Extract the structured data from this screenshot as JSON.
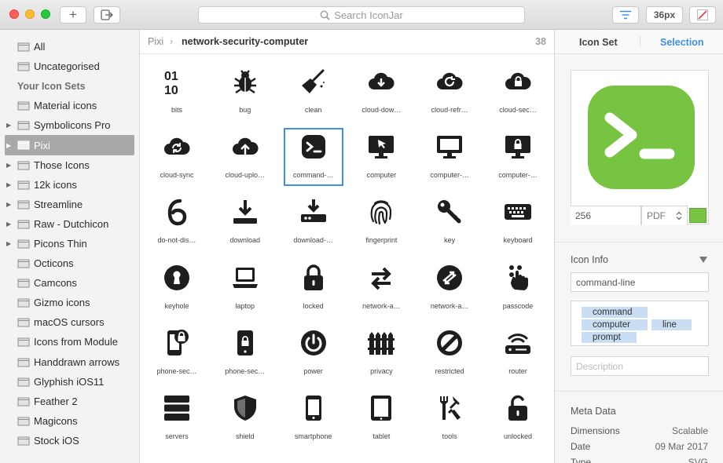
{
  "toolbar": {
    "add_label": "+",
    "search_placeholder": "Search IconJar",
    "size_label": "36px"
  },
  "sidebar": {
    "top_items": [
      {
        "label": "All"
      },
      {
        "label": "Uncategorised"
      }
    ],
    "sets_header": "Your Icon Sets",
    "sets": [
      {
        "label": "Material icons",
        "expandable": false
      },
      {
        "label": "Symbolicons Pro",
        "expandable": true
      },
      {
        "label": "Pixi",
        "expandable": true,
        "selected": true
      },
      {
        "label": "Those Icons",
        "expandable": true
      },
      {
        "label": "12k icons",
        "expandable": true
      },
      {
        "label": "Streamline",
        "expandable": true
      },
      {
        "label": "Raw - Dutchicon",
        "expandable": true
      },
      {
        "label": "Picons Thin",
        "expandable": true
      },
      {
        "label": "Octicons",
        "expandable": false
      },
      {
        "label": "Camcons",
        "expandable": false
      },
      {
        "label": "Gizmo icons",
        "expandable": false
      },
      {
        "label": "macOS cursors",
        "expandable": false
      },
      {
        "label": "Icons from Module",
        "expandable": false
      },
      {
        "label": "Handdrawn arrows",
        "expandable": false
      },
      {
        "label": "Glyphish iOS11",
        "expandable": false
      },
      {
        "label": "Feather 2",
        "expandable": false
      },
      {
        "label": "Magicons",
        "expandable": false
      },
      {
        "label": "Stock iOS",
        "expandable": false
      }
    ]
  },
  "main": {
    "breadcrumb_parent": "Pixi",
    "breadcrumb_sep": "›",
    "breadcrumb_current": "network-security-computer",
    "count": "38",
    "icons": [
      {
        "name": "bits",
        "icon": "bits-icon"
      },
      {
        "name": "bug",
        "icon": "bug-icon"
      },
      {
        "name": "clean",
        "icon": "broom-icon"
      },
      {
        "name": "cloud-dow…",
        "icon": "cloud-download-icon"
      },
      {
        "name": "cloud-refr…",
        "icon": "cloud-refresh-icon"
      },
      {
        "name": "cloud-sec…",
        "icon": "cloud-lock-icon"
      },
      {
        "name": "cloud-sync",
        "icon": "cloud-sync-icon"
      },
      {
        "name": "cloud-uplo…",
        "icon": "cloud-upload-icon"
      },
      {
        "name": "command-…",
        "icon": "command-line-icon",
        "selected": true
      },
      {
        "name": "computer",
        "icon": "computer-cursor-icon"
      },
      {
        "name": "computer-…",
        "icon": "computer-icon"
      },
      {
        "name": "computer-…",
        "icon": "computer-lock-icon"
      },
      {
        "name": "do-not-dis…",
        "icon": "do-not-disturb-icon"
      },
      {
        "name": "download",
        "icon": "download-icon"
      },
      {
        "name": "download-…",
        "icon": "download-drive-icon"
      },
      {
        "name": "fingerprint",
        "icon": "fingerprint-icon"
      },
      {
        "name": "key",
        "icon": "key-icon"
      },
      {
        "name": "keyboard",
        "icon": "keyboard-icon"
      },
      {
        "name": "keyhole",
        "icon": "keyhole-icon"
      },
      {
        "name": "laptop",
        "icon": "laptop-icon"
      },
      {
        "name": "locked",
        "icon": "lock-icon"
      },
      {
        "name": "network-a…",
        "icon": "network-arrows-icon"
      },
      {
        "name": "network-a…",
        "icon": "network-arrows-circle-icon"
      },
      {
        "name": "passcode",
        "icon": "passcode-icon"
      },
      {
        "name": "phone-sec…",
        "icon": "phone-security-icon"
      },
      {
        "name": "phone-sec…",
        "icon": "phone-lock-icon"
      },
      {
        "name": "power",
        "icon": "power-icon"
      },
      {
        "name": "privacy",
        "icon": "privacy-fence-icon"
      },
      {
        "name": "restricted",
        "icon": "restricted-icon"
      },
      {
        "name": "router",
        "icon": "router-icon"
      },
      {
        "name": "servers",
        "icon": "servers-icon"
      },
      {
        "name": "shield",
        "icon": "shield-icon"
      },
      {
        "name": "smartphone",
        "icon": "smartphone-icon"
      },
      {
        "name": "tablet",
        "icon": "tablet-icon"
      },
      {
        "name": "tools",
        "icon": "tools-icon"
      },
      {
        "name": "unlocked",
        "icon": "unlock-icon"
      }
    ]
  },
  "details": {
    "tab_iconset": "Icon Set",
    "tab_selection": "Selection",
    "preview_color": "#76c442",
    "size_value": "256",
    "format_value": "PDF",
    "color_swatch": "#76c442",
    "info_header": "Icon Info",
    "icon_name": "command-line",
    "tags": [
      "command",
      "computer",
      "line",
      "prompt"
    ],
    "description_placeholder": "Description",
    "meta_header": "Meta Data",
    "meta": [
      {
        "key": "Dimensions",
        "value": "Scalable"
      },
      {
        "key": "Date",
        "value": "09 Mar 2017"
      },
      {
        "key": "Type",
        "value": "SVG"
      }
    ]
  }
}
